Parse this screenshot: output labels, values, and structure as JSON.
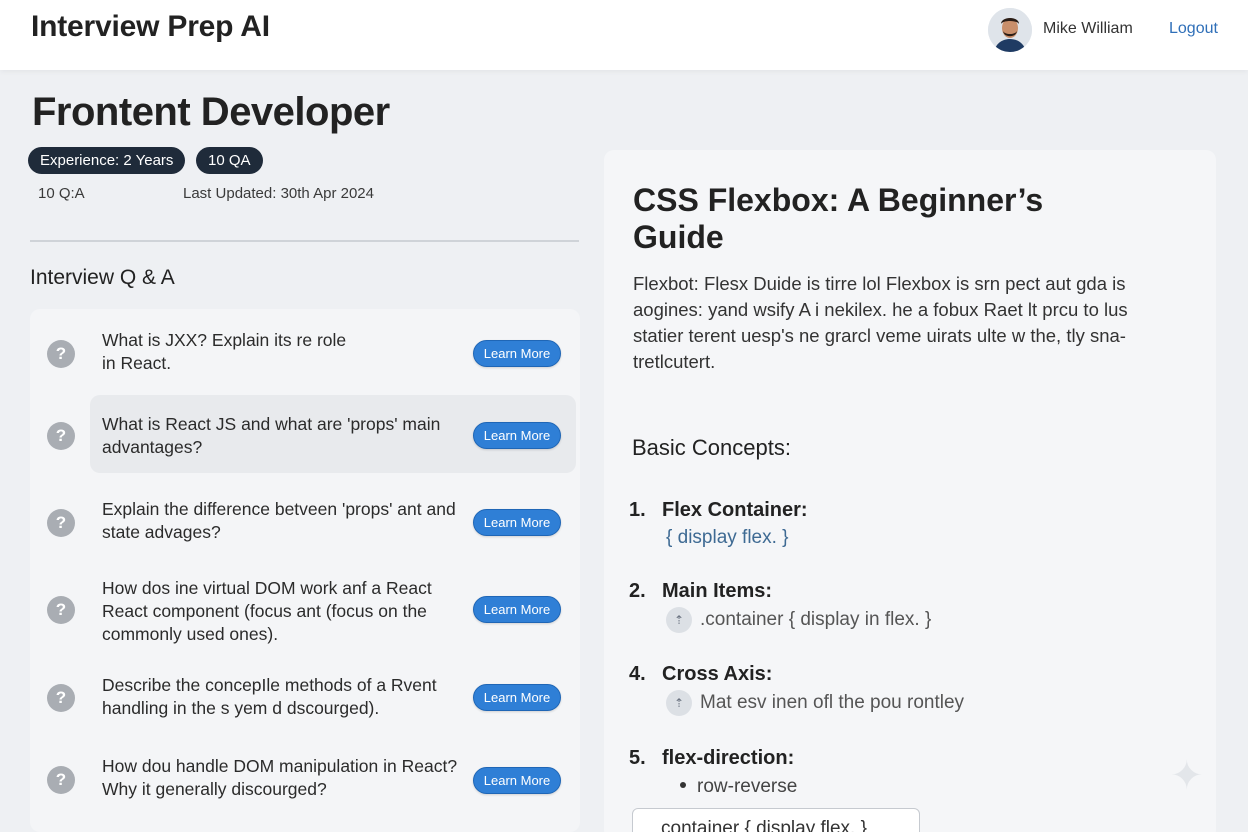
{
  "header": {
    "app_title": "Interview Prep AI",
    "user_name": "Mike William",
    "logout_label": "Logout"
  },
  "page": {
    "title": "Frontent Developer",
    "tags": [
      "Experience: 2 Years",
      "10 QA"
    ],
    "qa_count": "10 Q:A",
    "last_updated": "Last Updated: 30th Apr 2024",
    "section_title": "Interview Q & A"
  },
  "questions": [
    {
      "text": "What is JXX? Explain its re role in React.",
      "button": "Learn More"
    },
    {
      "text": "What is React JS and what are 'props' main advantages?",
      "button": "Learn More"
    },
    {
      "text": "Explain the difference betveen 'props' ant and state advages?",
      "button": "Learn More"
    },
    {
      "text": "How dos ine virtual DOM work anf a React React component (focus ant (focus on the commonly used ones).",
      "button": "Learn More"
    },
    {
      "text": "Describe the concepIle methods of a Rvent handling in the s yem d dscourged).",
      "button": "Learn More"
    },
    {
      "text": "How dou handle DOM manipulation in React? Why it generally discourged?",
      "button": "Learn More"
    }
  ],
  "guide": {
    "title": "CSS Flexbox: A Beginner’s Guide",
    "intro": "Flexbot: Flesx Duide is tirre lol Flexbox is srn pect aut gda is aogines: yand wsify A i nekilex. he a fobux Raet lt prcu to lus statier terent uesp's ne grarcl veme uirats ulte w the, tly sna-tretlcutert.",
    "basic_concepts_title": "Basic Concepts:",
    "items": [
      {
        "num": "1.",
        "title": "Flex Container:",
        "detail": "{ display flex. }"
      },
      {
        "num": "2.",
        "title": "Main Items:",
        "detail": ".container { display in flex. }"
      },
      {
        "num": "4.",
        "title": "Cross Axis:",
        "detail": "Mat esv inen ofl the pou rontley"
      },
      {
        "num": "5.",
        "title": "flex-direction:",
        "detail": "row-reverse"
      }
    ],
    "code_box": "container { display flex. }"
  },
  "icons": {
    "question": "question-circle-icon",
    "step": "arrow-up-circle-icon",
    "sparkle": "sparkle-icon"
  },
  "colors": {
    "primary_button": "#2f7fd6",
    "tag_bg": "#1f2b3a",
    "link": "#2f6fb8"
  }
}
